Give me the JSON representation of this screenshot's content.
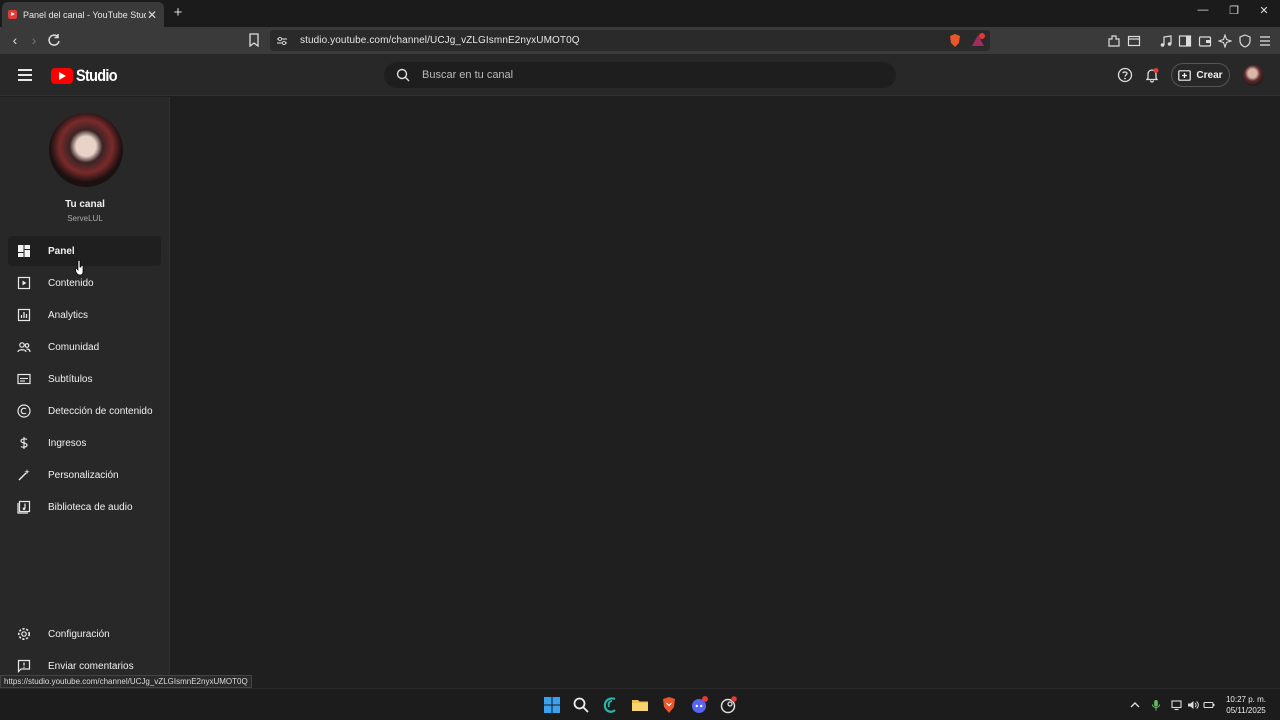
{
  "browser": {
    "tab_title": "Panel del canal - YouTube Studio",
    "url": "studio.youtube.com/channel/UCJg_vZLGIsmnE2nyxUMOT0Q",
    "status_url": "https://studio.youtube.com/channel/UCJg_vZLGIsmnE2nyxUMOT0Q"
  },
  "header": {
    "logo_text": "Studio",
    "search_placeholder": "Buscar en tu canal",
    "create_label": "Crear"
  },
  "sidebar": {
    "channel_title": "Tu canal",
    "channel_handle": "ServeLUL",
    "items": [
      {
        "label": "Panel",
        "icon": "dashboard-icon",
        "active": true
      },
      {
        "label": "Contenido",
        "icon": "content-icon"
      },
      {
        "label": "Analytics",
        "icon": "analytics-icon"
      },
      {
        "label": "Comunidad",
        "icon": "community-icon"
      },
      {
        "label": "Subtítulos",
        "icon": "subtitles-icon"
      },
      {
        "label": "Detección de contenido",
        "icon": "copyright-icon"
      },
      {
        "label": "Ingresos",
        "icon": "dollar-icon"
      },
      {
        "label": "Personalización",
        "icon": "magic-wand-icon"
      },
      {
        "label": "Biblioteca de audio",
        "icon": "audio-library-icon"
      }
    ],
    "bottom_items": [
      {
        "label": "Configuración",
        "icon": "gear-icon"
      },
      {
        "label": "Enviar comentarios",
        "icon": "feedback-icon"
      }
    ]
  },
  "taskbar": {
    "time": "10:27 p. m.",
    "date": "05/11/2025"
  },
  "colors": {
    "brand_red": "#ff0000",
    "background": "#1f1f1f",
    "surface": "#282828"
  }
}
